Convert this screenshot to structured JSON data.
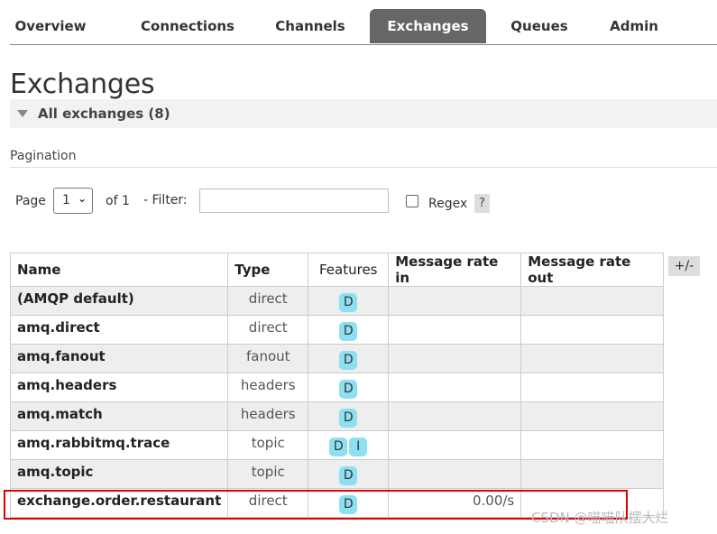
{
  "tabs": [
    {
      "label": "Overview",
      "active": false
    },
    {
      "label": "Connections",
      "active": false
    },
    {
      "label": "Channels",
      "active": false
    },
    {
      "label": "Exchanges",
      "active": true
    },
    {
      "label": "Queues",
      "active": false
    },
    {
      "label": "Admin",
      "active": false
    }
  ],
  "page_title": "Exchanges",
  "section": {
    "title": "All exchanges (8)",
    "icon": "triangle-down-icon"
  },
  "pagination": {
    "label": "Pagination",
    "page_label": "Page",
    "page_value": "1",
    "of_label": "of 1",
    "filter_label": "- Filter:",
    "filter_value": "",
    "regex_label": "Regex",
    "regex_checked": false,
    "help_label": "?"
  },
  "table": {
    "headers": [
      "Name",
      "Type",
      "Features",
      "Message rate in",
      "Message rate out"
    ],
    "columns_toggle": "+/-",
    "rows": [
      {
        "name": "(AMQP default)",
        "type": "direct",
        "features": [
          "D"
        ],
        "rate_in": "",
        "rate_out": ""
      },
      {
        "name": "amq.direct",
        "type": "direct",
        "features": [
          "D"
        ],
        "rate_in": "",
        "rate_out": ""
      },
      {
        "name": "amq.fanout",
        "type": "fanout",
        "features": [
          "D"
        ],
        "rate_in": "",
        "rate_out": ""
      },
      {
        "name": "amq.headers",
        "type": "headers",
        "features": [
          "D"
        ],
        "rate_in": "",
        "rate_out": ""
      },
      {
        "name": "amq.match",
        "type": "headers",
        "features": [
          "D"
        ],
        "rate_in": "",
        "rate_out": ""
      },
      {
        "name": "amq.rabbitmq.trace",
        "type": "topic",
        "features": [
          "D",
          "I"
        ],
        "rate_in": "",
        "rate_out": ""
      },
      {
        "name": "amq.topic",
        "type": "topic",
        "features": [
          "D"
        ],
        "rate_in": "",
        "rate_out": ""
      },
      {
        "name": "exchange.order.restaurant",
        "type": "direct",
        "features": [
          "D"
        ],
        "rate_in": "0.00/s",
        "rate_out": ""
      }
    ]
  },
  "watermark": "CSDN @喵喵队摆大烂",
  "colors": {
    "active_tab": "#666666",
    "badge": "#8de0f1",
    "highlight": "#e00000"
  }
}
